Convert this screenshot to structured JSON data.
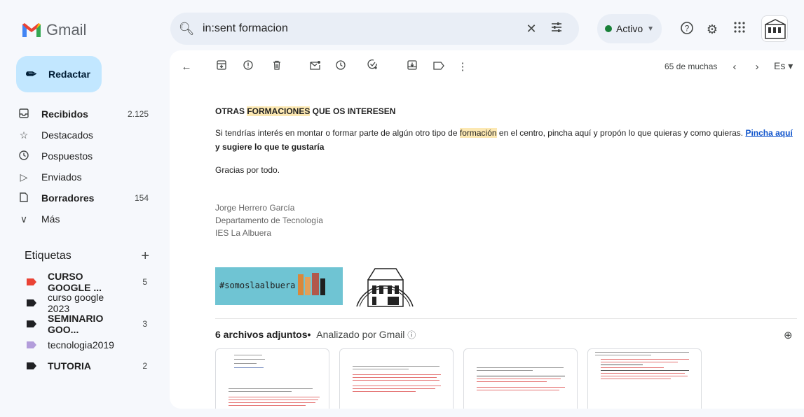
{
  "app": {
    "name": "Gmail"
  },
  "search": {
    "value": "in:sent formacion"
  },
  "status": {
    "label": "Activo"
  },
  "compose": {
    "label": "Redactar"
  },
  "nav": [
    {
      "label": "Recibidos",
      "count": "2.125",
      "bold": true,
      "icon": "inbox-icon"
    },
    {
      "label": "Destacados",
      "count": "",
      "bold": false,
      "icon": "star-icon"
    },
    {
      "label": "Pospuestos",
      "count": "",
      "bold": false,
      "icon": "clock-icon"
    },
    {
      "label": "Enviados",
      "count": "",
      "bold": false,
      "icon": "send-icon"
    },
    {
      "label": "Borradores",
      "count": "154",
      "bold": true,
      "icon": "draft-icon"
    },
    {
      "label": "Más",
      "count": "",
      "bold": false,
      "icon": "chevron-down-icon"
    }
  ],
  "labels_title": "Etiquetas",
  "labels": [
    {
      "label": "CURSO GOOGLE ...",
      "count": "5",
      "bold": true,
      "color": "#ea4335"
    },
    {
      "label": "curso google 2023",
      "count": "",
      "bold": false,
      "color": "#202124"
    },
    {
      "label": "SEMINARIO GOO...",
      "count": "3",
      "bold": true,
      "color": "#202124"
    },
    {
      "label": "tecnologia2019",
      "count": "",
      "bold": false,
      "color": "#b39ddb"
    },
    {
      "label": "TUTORIA",
      "count": "2",
      "bold": true,
      "color": "#202124"
    }
  ],
  "pager": {
    "text": "65 de muchas"
  },
  "lang": {
    "text": "Es"
  },
  "email": {
    "heading_pre": "OTRAS ",
    "heading_hl": "FORMACIONES",
    "heading_post": " QUE OS INTERESEN",
    "p1_pre": "Si tendrías interés en montar o formar parte de algún otro tipo de ",
    "p1_hl": "formación",
    "p1_mid": " en el centro, pincha aquí y propón lo que quieras y como quieras. ",
    "p1_link": "Pincha aquí ",
    "p1_bold": "y sugiere lo que te gustaría",
    "p2": "Gracias por todo.",
    "sig_name": "Jorge Herrero García",
    "sig_dept": "Departamento de Tecnología",
    "sig_school": "IES La Albuera",
    "banner_text": "#somoslaalbuera"
  },
  "attachments": {
    "title": "6 archivos adjuntos",
    "analyzed": "Analizado por Gmail"
  },
  "colors": {
    "accent": "#c2e7ff",
    "highlight": "#fce8b2",
    "link": "#1155cc",
    "banner": "#6fc4d3"
  }
}
